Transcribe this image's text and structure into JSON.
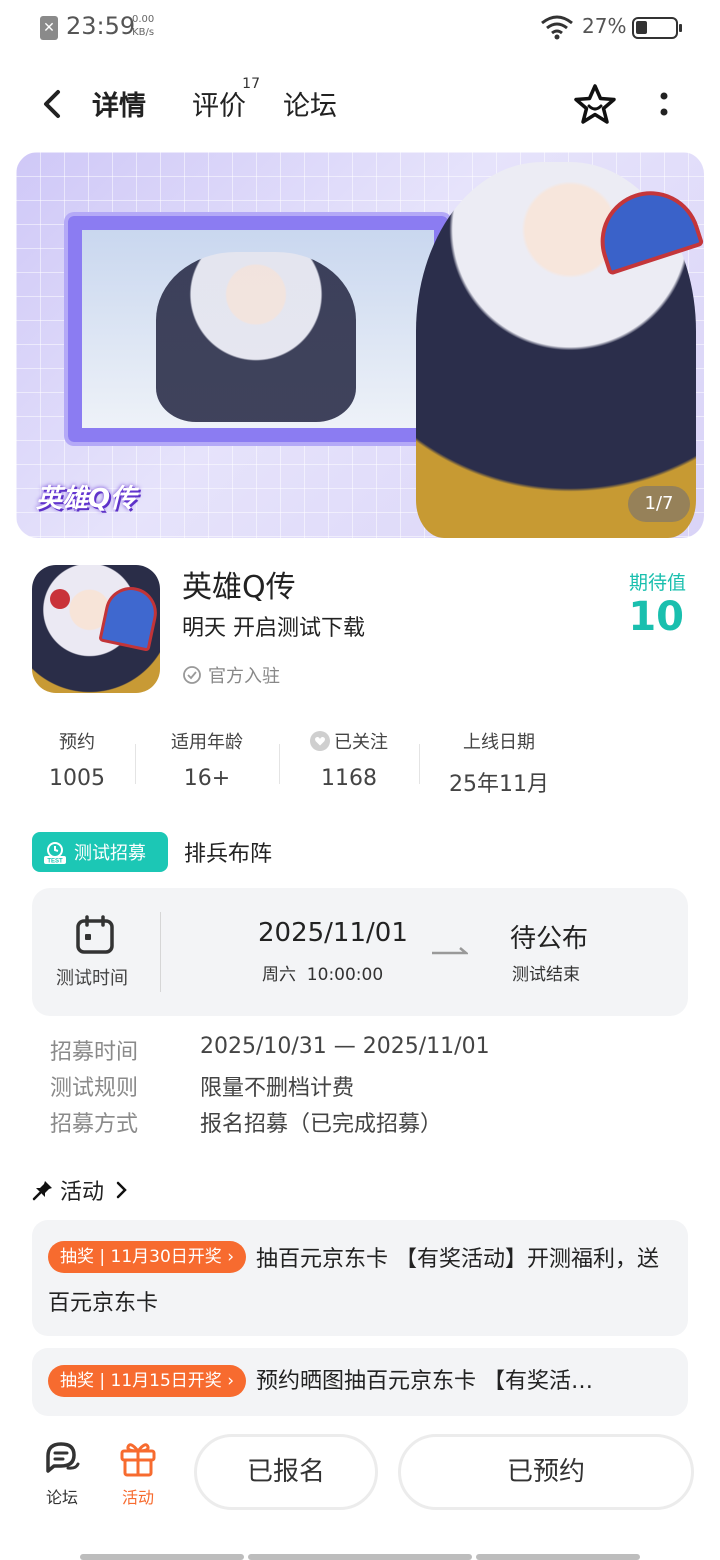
{
  "status_bar": {
    "time": "23:59",
    "speed_value": "0.00",
    "speed_unit": "KB/s",
    "battery": "27%"
  },
  "nav": {
    "tabs": [
      {
        "label": "详情",
        "active": true
      },
      {
        "label": "评价",
        "badge": "17"
      },
      {
        "label": "论坛"
      }
    ]
  },
  "banner": {
    "logo_text": "英雄Q传",
    "counter": "1/7"
  },
  "game": {
    "title": "英雄Q传",
    "subtitle": "明天 开启测试下载",
    "official": "官方入驻",
    "expect_label": "期待值",
    "expect_value": "10"
  },
  "stats": [
    {
      "label": "预约",
      "value": "1005"
    },
    {
      "label": "适用年龄",
      "value": "16+"
    },
    {
      "label": "已关注",
      "value": "1168"
    },
    {
      "label": "上线日期",
      "value": "25年11月"
    }
  ],
  "recruit": {
    "badge_label": "测试招募",
    "badge_icon_text": "TEST",
    "name": "排兵布阵",
    "test_time_label": "测试时间",
    "start_date": "2025/11/01",
    "start_sub": "周六  10:00:00",
    "end_status": "待公布",
    "end_sub": "测试结束",
    "info": [
      {
        "key": "招募时间",
        "value": "2025/10/31 — 2025/11/01"
      },
      {
        "key": "测试规则",
        "value": "限量不删档计费"
      },
      {
        "key": "招募方式",
        "value": "报名招募（已完成招募）"
      }
    ]
  },
  "activities": {
    "title": "活动",
    "items": [
      {
        "tag": "抽奖 | 11月30日开奖 ›",
        "text": "抽百元京东卡 【有奖活动】开测福利，送百元京东卡"
      },
      {
        "tag": "抽奖 | 11月15日开奖 ›",
        "text": "预约晒图抽百元京东卡 【有奖活…"
      }
    ]
  },
  "bottom_bar": {
    "forum_label": "论坛",
    "activity_label": "活动",
    "signed_button": "已报名",
    "reserved_button": "已预约"
  },
  "colors": {
    "accent": "#19c8b9",
    "orange": "#f76b2f",
    "card_bg": "#f3f4f6"
  }
}
